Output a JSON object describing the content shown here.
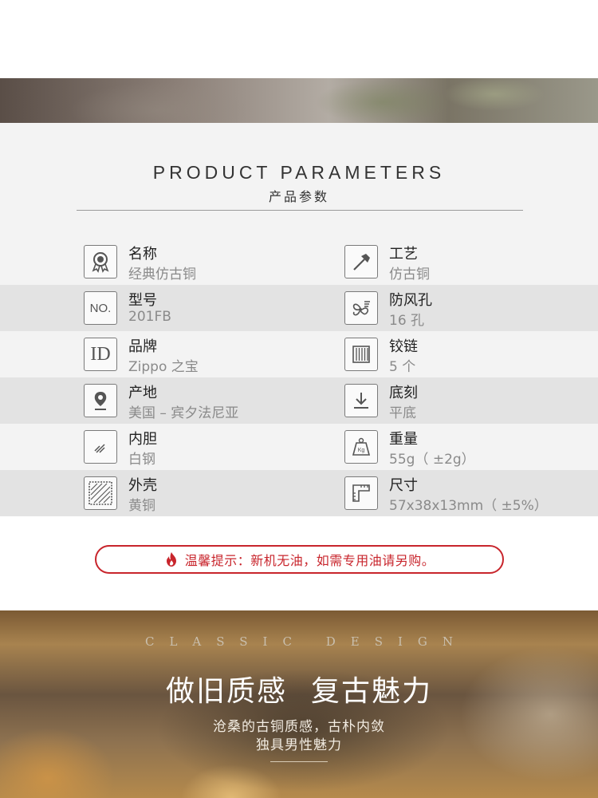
{
  "header": {
    "title_en": "PRODUCT PARAMETERS",
    "title_cn": "产品参数"
  },
  "params": [
    {
      "label": "名称",
      "value": "经典仿古铜",
      "icon": "award-badge-icon"
    },
    {
      "label": "工艺",
      "value": "仿古铜",
      "icon": "hammer-icon"
    },
    {
      "label": "型号",
      "value": "201FB",
      "icon": "model-number-icon",
      "icon_text": "NO."
    },
    {
      "label": "防风孔",
      "value": "16 孔",
      "icon": "windproof-fan-icon"
    },
    {
      "label": "品牌",
      "value": "Zippo 之宝",
      "icon": "brand-id-icon",
      "icon_text": "ID"
    },
    {
      "label": "铰链",
      "value": "5 个",
      "icon": "hinge-icon"
    },
    {
      "label": "产地",
      "value": "美国 – 宾夕法尼亚",
      "icon": "location-pin-icon"
    },
    {
      "label": "底刻",
      "value": "平底",
      "icon": "download-arrow-icon"
    },
    {
      "label": "内胆",
      "value": "白钢",
      "icon": "inner-liner-icon"
    },
    {
      "label": "重量",
      "value": "55g（ ±2g）",
      "icon": "weight-icon",
      "icon_text": "Kg"
    },
    {
      "label": "外壳",
      "value": "黄铜",
      "icon": "outer-shell-icon"
    },
    {
      "label": "尺寸",
      "value": "57x38x13mm（ ±5%）",
      "icon": "ruler-icon"
    }
  ],
  "tip": {
    "text": "温馨提示：新机无油，如需专用油请另购。",
    "icon": "flame-icon",
    "color": "#c8252c"
  },
  "banner": {
    "subtitle_en": "CLASSIC DESIGN",
    "headline_left": "做旧质感",
    "headline_right": "复古魅力",
    "line1": "沧桑的古铜质感，古朴内敛",
    "line2": "独具男性魅力"
  }
}
